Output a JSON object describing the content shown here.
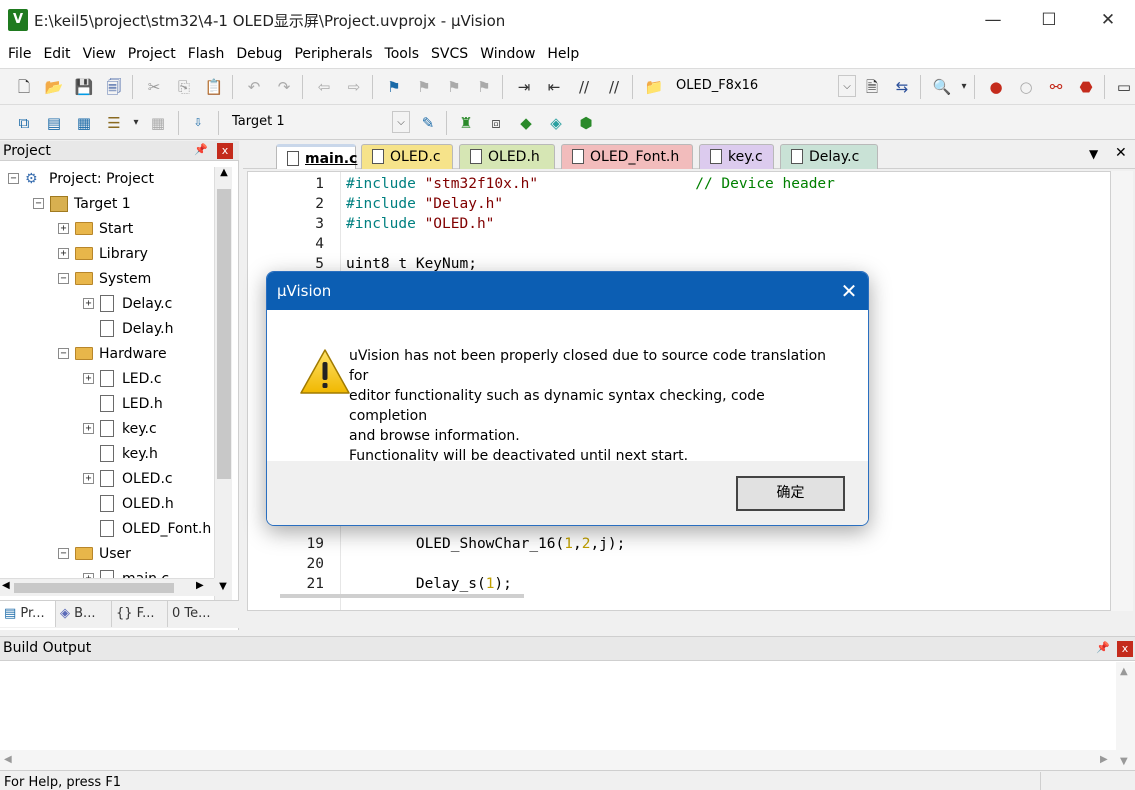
{
  "window": {
    "app_icon": "V",
    "title": "E:\\keil5\\project\\stm32\\4-1 OLED显示屏\\Project.uvprojx - µVision",
    "minimize": "—",
    "maximize": "☐",
    "close": "✕"
  },
  "menu": [
    "File",
    "Edit",
    "View",
    "Project",
    "Flash",
    "Debug",
    "Peripherals",
    "Tools",
    "SVCS",
    "Window",
    "Help"
  ],
  "toolbar": {
    "find_combo_value": "OLED_F8x16",
    "target_combo_value": "Target 1"
  },
  "project_panel": {
    "title": "Project",
    "pin": "📌",
    "close": "x",
    "tree": [
      {
        "label": "Project: Project",
        "icon": "project-icon",
        "expander": "−"
      },
      {
        "label": "Target 1",
        "icon": "target-icon",
        "expander": "−"
      },
      {
        "label": "Start",
        "icon": "folder-icon",
        "expander": "+"
      },
      {
        "label": "Library",
        "icon": "folder-icon",
        "expander": "+"
      },
      {
        "label": "System",
        "icon": "folder-icon",
        "expander": "−"
      },
      {
        "label": "Delay.c",
        "icon": "file-icon",
        "expander": "+"
      },
      {
        "label": "Delay.h",
        "icon": "file-icon",
        "expander": ""
      },
      {
        "label": "Hardware",
        "icon": "folder-icon",
        "expander": "−"
      },
      {
        "label": "LED.c",
        "icon": "file-icon",
        "expander": "+"
      },
      {
        "label": "LED.h",
        "icon": "file-icon",
        "expander": ""
      },
      {
        "label": "key.c",
        "icon": "file-icon",
        "expander": "+"
      },
      {
        "label": "key.h",
        "icon": "file-icon",
        "expander": ""
      },
      {
        "label": "OLED.c",
        "icon": "file-icon",
        "expander": "+"
      },
      {
        "label": "OLED.h",
        "icon": "file-icon",
        "expander": ""
      },
      {
        "label": "OLED_Font.h",
        "icon": "file-icon",
        "expander": ""
      },
      {
        "label": "User",
        "icon": "folder-icon",
        "expander": "−"
      },
      {
        "label": "main.c",
        "icon": "file-icon",
        "expander": "+"
      }
    ],
    "bottom_tabs": [
      "Pr...",
      "B...",
      "{} F...",
      "0 Te..."
    ]
  },
  "editor": {
    "tabs": [
      {
        "label": "main.c",
        "color": "#c9d7ea",
        "active": true
      },
      {
        "label": "OLED.c",
        "color": "#f6e38a"
      },
      {
        "label": "OLED.h",
        "color": "#d6e6b4"
      },
      {
        "label": "OLED_Font.h",
        "color": "#f2bcbc"
      },
      {
        "label": "key.c",
        "color": "#dccbee"
      },
      {
        "label": "Delay.c",
        "color": "#c9e2d6"
      }
    ],
    "tab_menu": "▼",
    "tab_close": "✕",
    "lines": [
      {
        "n": "1",
        "parts": [
          {
            "t": "#include ",
            "c": "kw"
          },
          {
            "t": "\"stm32f10x.h\"",
            "c": "str"
          },
          {
            "t": "                  // Device header",
            "c": "cm"
          }
        ]
      },
      {
        "n": "2",
        "parts": [
          {
            "t": "#include ",
            "c": "kw"
          },
          {
            "t": "\"Delay.h\"",
            "c": "str"
          }
        ]
      },
      {
        "n": "3",
        "parts": [
          {
            "t": "#include ",
            "c": "kw"
          },
          {
            "t": "\"OLED.h\"",
            "c": "str"
          }
        ]
      },
      {
        "n": "4",
        "parts": []
      },
      {
        "n": "5",
        "parts": [
          {
            "t": "uint8_t KeyNum;",
            "c": ""
          }
        ]
      },
      {
        "n": "19",
        "parts": [
          {
            "t": "        OLED_ShowChar_16(",
            "c": ""
          },
          {
            "t": "1",
            "c": "num"
          },
          {
            "t": ",",
            "c": ""
          },
          {
            "t": "2",
            "c": "num"
          },
          {
            "t": ",j);",
            "c": ""
          }
        ]
      },
      {
        "n": "20",
        "parts": []
      },
      {
        "n": "21",
        "parts": [
          {
            "t": "        Delay_s(",
            "c": ""
          },
          {
            "t": "1",
            "c": "num"
          },
          {
            "t": ");",
            "c": ""
          }
        ]
      }
    ]
  },
  "build_output": {
    "title": "Build Output",
    "pin": "📌",
    "close": "x"
  },
  "status_bar": {
    "text": "For Help, press F1"
  },
  "dialog": {
    "title": "µVision",
    "close": "✕",
    "message_lines": [
      "uVision has not been properly closed due to source code translation for",
      "editor functionality such as dynamic syntax checking, code completion",
      "and browse information.",
      "Functionality will be deactivated until next start."
    ],
    "ok_label": "确定"
  }
}
